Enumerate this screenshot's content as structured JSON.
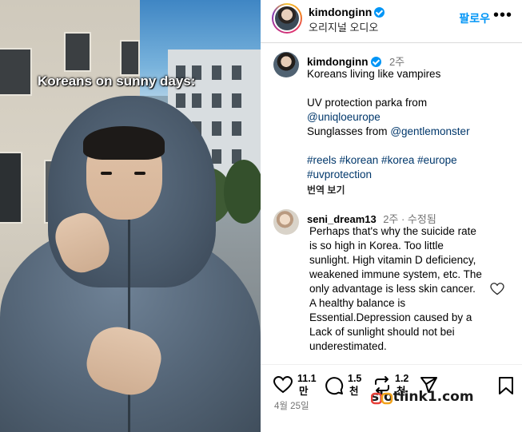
{
  "media": {
    "caption": "Koreans on sunny days:"
  },
  "header": {
    "username": "kimdonginn",
    "subtitle": "오리지널 오디오",
    "follow_label": "팔로우",
    "more_icon": "more-horizontal-icon"
  },
  "post": {
    "username": "kimdonginn",
    "time": "2주",
    "lines": [
      "Koreans living like vampires",
      "",
      "UV protection parka from",
      "@uniqloeurope",
      "Sunglasses from"
    ],
    "mention_sunglasses": "@gentlemonster",
    "hashtags_line1": "#reels #korean #korea #europe",
    "hashtags_line2": "#uvprotection",
    "translate": "번역 보기"
  },
  "comment": {
    "username": "seni_dream13",
    "meta": "2주 · 수정됨",
    "lines": [
      "Perhaps that's why the suicide rate",
      "is so high in Korea. Too little",
      "sunlight. High vitamin D deficiency,",
      "weakened immune system, etc. The",
      "only advantage is less skin cancer.",
      "A healthy balance is",
      "Essential.Depression caused by a",
      "Lack of sunlight should not bei",
      "underestimated."
    ]
  },
  "actions": {
    "likes_1": "11.1",
    "likes_2": "만",
    "comments_1": "1.5",
    "comments_2": "천",
    "reposts_1": "1.2",
    "reposts_2": "천"
  },
  "date": "4월 25일",
  "watermark": "slotlink1.com",
  "colors": {
    "accent": "#0095f6",
    "link": "#00376b",
    "muted": "#737373"
  }
}
